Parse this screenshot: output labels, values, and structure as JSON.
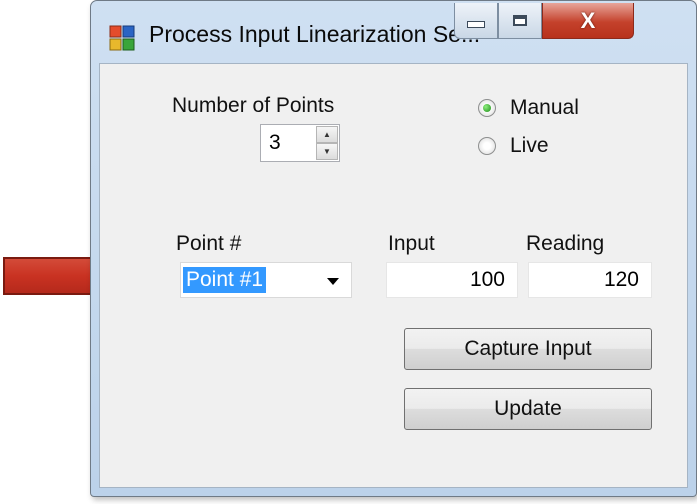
{
  "window": {
    "title": "Process Input Linearization Se...",
    "close_label": "X"
  },
  "points": {
    "label": "Number of Points",
    "value": "3"
  },
  "mode": {
    "manual_label": "Manual",
    "live_label": "Live",
    "selected": "Manual"
  },
  "table": {
    "point_header": "Point #",
    "input_header": "Input",
    "reading_header": "Reading",
    "point_selected": "Point #1",
    "input_value": "100",
    "reading_value": "120"
  },
  "buttons": {
    "capture": "Capture Input",
    "update": "Update"
  },
  "colors": {
    "arrow": "#c62e22",
    "selection": "#3399ff",
    "close_button": "#c4412b"
  },
  "icons": {
    "arrow": "red-arrow-icon",
    "app": "app-window-icon"
  }
}
